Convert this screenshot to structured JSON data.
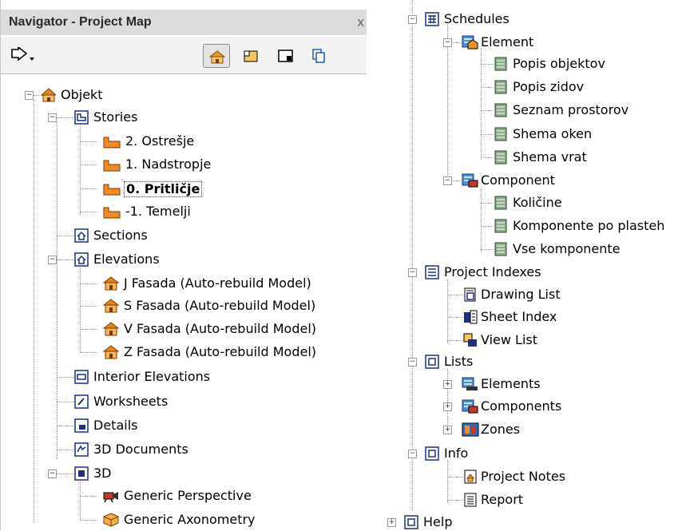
{
  "navigator": {
    "title": "Navigator - Project Map",
    "close": "x",
    "toolbar": {
      "buttons": [
        {
          "icon": "publish-arrow-icon"
        },
        {
          "icon": "project-map-icon",
          "pressed": true
        },
        {
          "icon": "view-map-icon"
        },
        {
          "icon": "layout-book-icon"
        },
        {
          "icon": "publisher-sets-icon"
        }
      ]
    },
    "tree": {
      "objekt": "Objekt",
      "stories": "Stories",
      "stories_items": [
        "2. Ostrešje",
        "1. Nadstropje",
        "0. Pritličje",
        "-1. Temelji"
      ],
      "sections": "Sections",
      "elevations": "Elevations",
      "elevation_items": [
        "J Fasada (Auto-rebuild Model)",
        "S Fasada (Auto-rebuild Model)",
        "V Fasada (Auto-rebuild Model)",
        "Z Fasada (Auto-rebuild Model)"
      ],
      "interior_elevations": "Interior Elevations",
      "worksheets": "Worksheets",
      "details": "Details",
      "documents_3d": "3D Documents",
      "three_d": "3D",
      "three_d_items": [
        "Generic Perspective",
        "Generic Axonometry"
      ],
      "schedules": "Schedules",
      "element": "Element",
      "element_items": [
        "Popis objektov",
        "Popis zidov",
        "Seznam prostorov",
        "Shema oken",
        "Shema vrat"
      ],
      "component": "Component",
      "component_items": [
        "Količine",
        "Komponente po plasteh",
        "Vse komponente"
      ],
      "project_indexes": "Project Indexes",
      "index_items": [
        "Drawing List",
        "Sheet Index",
        "View List"
      ],
      "lists": "Lists",
      "list_items": [
        "Elements",
        "Components",
        "Zones"
      ],
      "info": "Info",
      "info_items": [
        "Project Notes",
        "Report"
      ],
      "help": "Help"
    }
  }
}
